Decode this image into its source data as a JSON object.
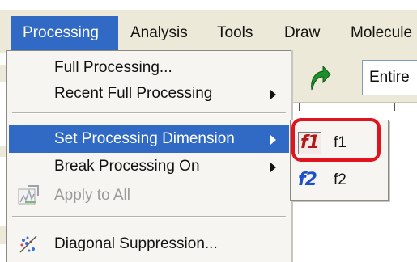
{
  "menubar": {
    "menus": [
      {
        "label": "Processing",
        "active": true
      },
      {
        "label": "Analysis"
      },
      {
        "label": "Tools"
      },
      {
        "label": "Draw"
      },
      {
        "label": "Molecule"
      }
    ]
  },
  "toolbar": {
    "arrow_icon": "green-curved-arrow-icon",
    "scope_value": "Entire"
  },
  "processing_menu": {
    "items": [
      {
        "label": "Full Processing...",
        "has_submenu": false
      },
      {
        "label": "Recent Full Processing",
        "has_submenu": true
      },
      {
        "label": "Set Processing Dimension",
        "has_submenu": true,
        "highlighted": true
      },
      {
        "label": "Break Processing On",
        "has_submenu": true
      },
      {
        "label": "Apply to All",
        "disabled": true,
        "icon": "apply-all-icon"
      },
      {
        "label": "Diagonal Suppression...",
        "icon": "diagonal-suppression-icon"
      }
    ]
  },
  "dimension_submenu": {
    "items": [
      {
        "icon_text": "f1",
        "label": "f1",
        "selected": true
      },
      {
        "icon_text": "f2",
        "label": "f2"
      }
    ]
  },
  "colors": {
    "highlight": "#316ac5",
    "callout": "#e0141e",
    "f1_icon": "#b01818",
    "f2_icon": "#1b50c8"
  }
}
